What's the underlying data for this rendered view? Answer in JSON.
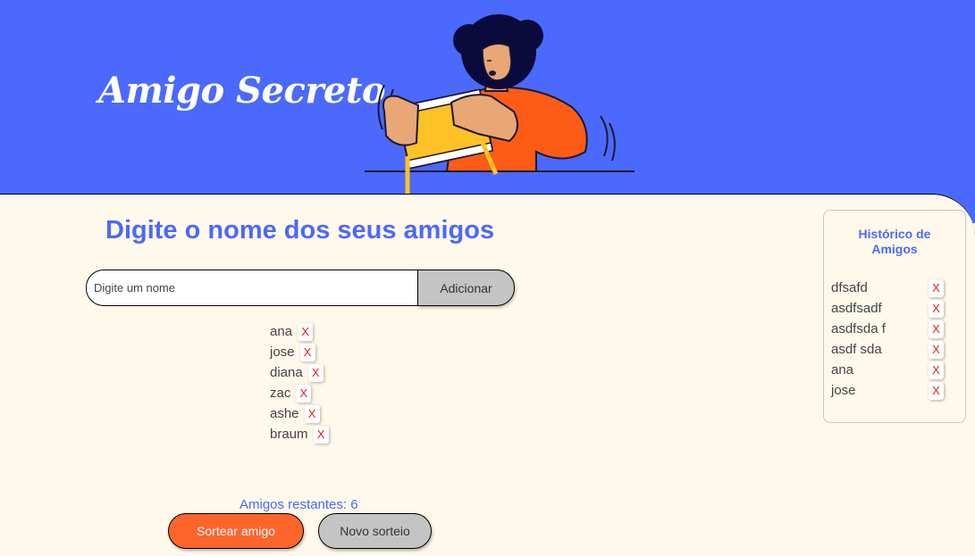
{
  "header": {
    "title": "Amigo Secreto",
    "bg_color": "#4B69FD"
  },
  "main": {
    "section_title": "Digite o nome dos seus amigos",
    "input_placeholder": "Digite um nome",
    "input_value": "",
    "add_button": "Adicionar",
    "friends": [
      {
        "name": "ana",
        "remove": "X"
      },
      {
        "name": "jose",
        "remove": "X"
      },
      {
        "name": "diana",
        "remove": "X"
      },
      {
        "name": "zac",
        "remove": "X"
      },
      {
        "name": "ashe",
        "remove": "X"
      },
      {
        "name": "braum",
        "remove": "X"
      }
    ],
    "remaining_text": "Amigos restantes: 6",
    "draw_button": "Sortear amigo",
    "new_draw_button": "Novo sorteio"
  },
  "history": {
    "title": "Histórico de Amigos",
    "items": [
      {
        "name": "dfsafd",
        "remove": "X"
      },
      {
        "name": "asdfsadf",
        "remove": "X"
      },
      {
        "name": "asdfsda f",
        "remove": "X"
      },
      {
        "name": "asdf sda",
        "remove": "X"
      },
      {
        "name": "ana",
        "remove": "X"
      },
      {
        "name": "jose",
        "remove": "X"
      }
    ]
  },
  "colors": {
    "accent": "#4B69FD",
    "primary_button": "#FE652B",
    "secondary_button": "#C4C4C4",
    "background": "#FFF9EB",
    "remove_icon": "#E02020"
  }
}
